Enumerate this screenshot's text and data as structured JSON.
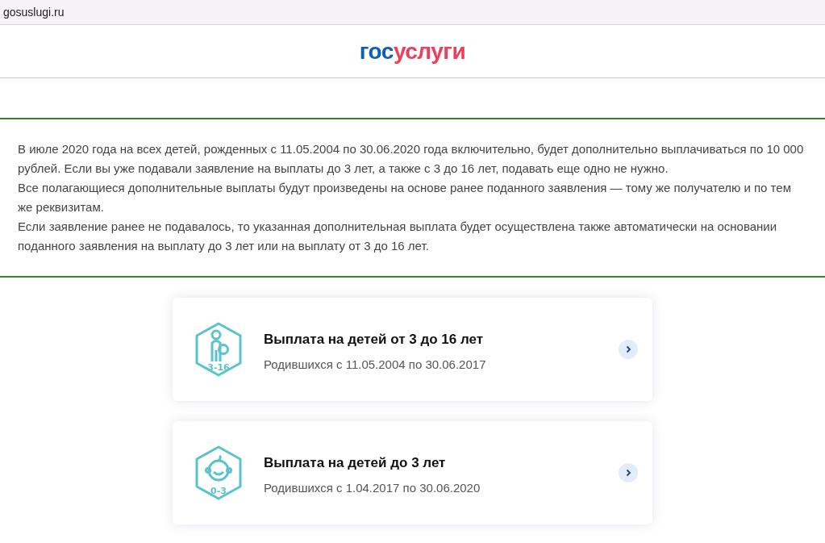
{
  "address_bar": {
    "url": "gosuslugi.ru"
  },
  "logo": {
    "first": "гос",
    "second": "услуги"
  },
  "notice": {
    "paragraphs": [
      "В июле 2020 года на всех детей, рожденных с 11.05.2004 по 30.06.2020 года включительно, будет дополнительно выплачиваться по 10 000 рублей. Если вы уже подавали заявление на выплаты до 3 лет, а также с 3 до 16 лет, подавать еще одно не нужно.",
      "Все полагающиеся дополнительные выплаты будут произведены на основе ранее поданного заявления — тому же получателю и по тем же реквизитам.",
      "Если заявление ранее не подавалось, то указанная дополнительная выплата будет осуществлена также автоматически на основании поданного заявления на выплату до 3 лет или на выплату от 3 до 16 лет."
    ]
  },
  "cards": [
    {
      "kind": "child",
      "age_label": "3-16",
      "title": "Выплата на детей от 3 до 16 лет",
      "subtitle": "Родившихся с 11.05.2004 по 30.06.2017"
    },
    {
      "kind": "baby",
      "age_label": "0-3",
      "title": "Выплата на детей до 3 лет",
      "subtitle": "Родившихся с 1.04.2017 по 30.06.2020"
    }
  ]
}
